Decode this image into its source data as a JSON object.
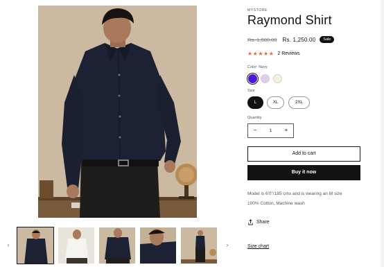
{
  "gallery": {
    "main_image": "man in navy shirt",
    "thumbnails": [
      {
        "name": "navy shirt front",
        "active": true
      },
      {
        "name": "white shirt",
        "active": false
      },
      {
        "name": "navy shirt detail",
        "active": false
      },
      {
        "name": "navy shirt collar close-up",
        "active": false
      },
      {
        "name": "navy shirt full length",
        "active": false
      }
    ],
    "prev_icon": "chevron-left-icon",
    "next_icon": "chevron-right-icon"
  },
  "product": {
    "vendor": "MYSTORE",
    "title": "Raymond Shirt",
    "price_regular": "Rs. 1,500.00",
    "price_sale": "Rs. 1,250.00",
    "sale_badge": "Sale",
    "rating": 5,
    "stars": "★★★★★",
    "reviews_label": "2 Reviews",
    "color_label": "Color: Navy",
    "colors": [
      {
        "name": "Navy",
        "hex": "#4a17e0",
        "selected": true
      },
      {
        "name": "Lavender",
        "hex": "#e5c9ea",
        "selected": false
      },
      {
        "name": "Cream",
        "hex": "#f3f1e0",
        "selected": false
      }
    ],
    "size_label": "Size",
    "sizes": [
      {
        "label": "L",
        "selected": true
      },
      {
        "label": "XL",
        "selected": false
      },
      {
        "label": "2XL",
        "selected": false
      }
    ],
    "quantity_label": "Quantity",
    "quantity": "1",
    "minus": "−",
    "plus": "+",
    "add_to_cart": "Add to cart",
    "buy_now": "Buy it now",
    "description_1": "Model is 6'0\"/185 cms and is wearing an M size",
    "description_2": "100% Cotton, Machine wash",
    "share_label": "Share",
    "share_icon": "share-icon",
    "size_chart": "Size chart"
  },
  "colors": {
    "accent_star": "#e5683a",
    "dark": "#121212",
    "muted": "#555555"
  }
}
